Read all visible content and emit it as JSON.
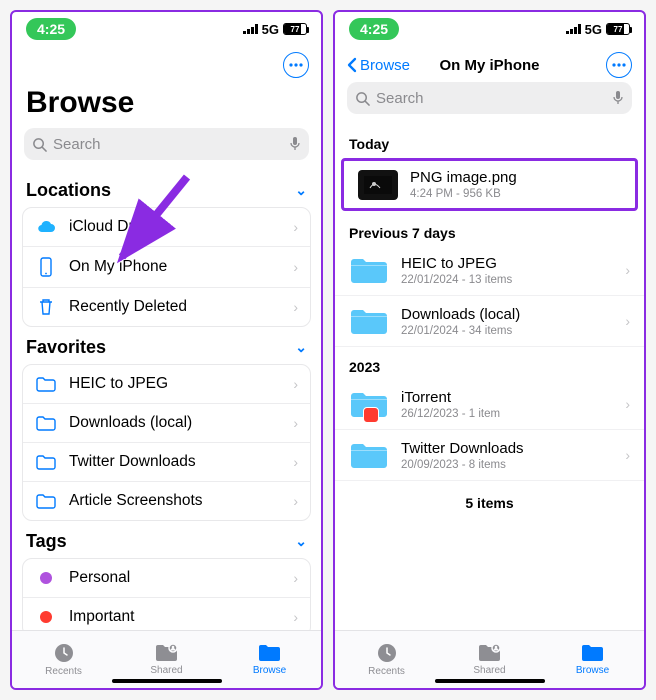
{
  "status": {
    "time": "4:25",
    "network": "5G",
    "battery": "77"
  },
  "left": {
    "title": "Browse",
    "search_placeholder": "Search",
    "sections": {
      "locations_header": "Locations",
      "favorites_header": "Favorites",
      "tags_header": "Tags"
    },
    "locations": [
      {
        "label": "iCloud Drive",
        "icon": "cloud"
      },
      {
        "label": "On My iPhone",
        "icon": "phone"
      },
      {
        "label": "Recently Deleted",
        "icon": "trash"
      }
    ],
    "favorites": [
      {
        "label": "HEIC to JPEG"
      },
      {
        "label": "Downloads (local)"
      },
      {
        "label": "Twitter Downloads"
      },
      {
        "label": "Article Screenshots"
      }
    ],
    "tags": [
      {
        "label": "Personal",
        "color": "#af52de"
      },
      {
        "label": "Important",
        "color": "#ff3b30"
      }
    ]
  },
  "right": {
    "back_label": "Browse",
    "title": "On My iPhone",
    "search_placeholder": "Search",
    "groups": {
      "today": "Today",
      "prev7": "Previous 7 days",
      "y2023": "2023"
    },
    "today": [
      {
        "name": "PNG image.png",
        "meta": "4:24 PM - 956 KB"
      }
    ],
    "prev7": [
      {
        "name": "HEIC to JPEG",
        "meta": "22/01/2024 - 13 items"
      },
      {
        "name": "Downloads (local)",
        "meta": "22/01/2024 - 34 items"
      }
    ],
    "y2023": [
      {
        "name": "iTorrent",
        "meta": "26/12/2023 - 1 item",
        "badge": true
      },
      {
        "name": "Twitter Downloads",
        "meta": "20/09/2023 - 8 items"
      }
    ],
    "count_label": "5 items"
  },
  "tabs": {
    "recents": "Recents",
    "shared": "Shared",
    "browse": "Browse"
  }
}
